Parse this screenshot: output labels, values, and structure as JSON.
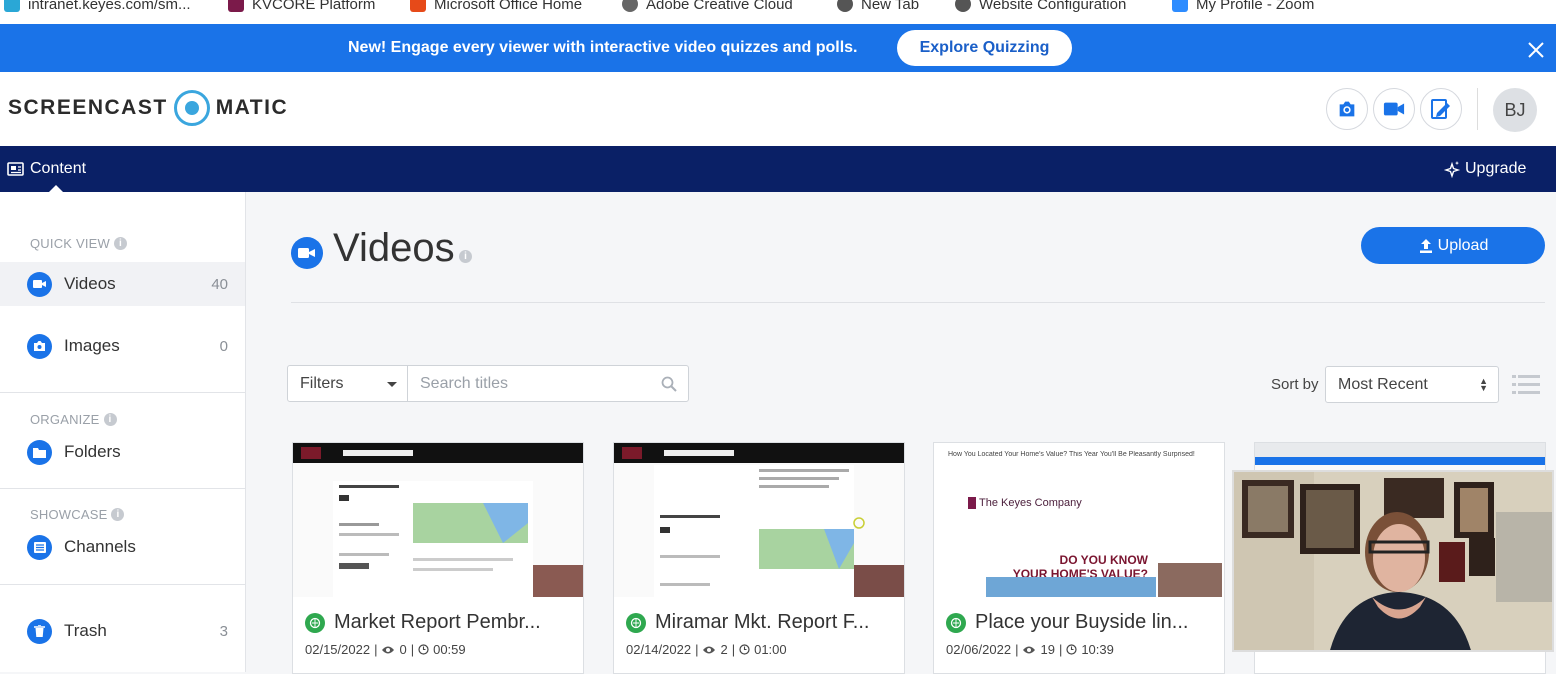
{
  "bookmarks": [
    {
      "label": "intranet.keyes.com/sm..."
    },
    {
      "label": "KVCORE Platform"
    },
    {
      "label": "Microsoft Office Home"
    },
    {
      "label": "Adobe Creative Cloud"
    },
    {
      "label": "New Tab"
    },
    {
      "label": "Website Configuration"
    },
    {
      "label": "My Profile - Zoom"
    }
  ],
  "promo": {
    "text": "New! Engage every viewer with interactive video quizzes and polls.",
    "button": "Explore Quizzing"
  },
  "header": {
    "logo_left": "SCREENCAST",
    "logo_right": "MATIC",
    "avatar_initials": "BJ"
  },
  "navbar": {
    "content_label": "Content",
    "upgrade_label": "Upgrade"
  },
  "sidebar": {
    "quick_view_title": "QUICK VIEW",
    "organize_title": "ORGANIZE",
    "showcase_title": "SHOWCASE",
    "items": [
      {
        "label": "Videos",
        "count": "40",
        "icon": "video-camera-icon"
      },
      {
        "label": "Images",
        "count": "0",
        "icon": "camera-icon"
      },
      {
        "label": "Folders",
        "count": "",
        "icon": "folder-icon"
      },
      {
        "label": "Channels",
        "count": "",
        "icon": "list-icon"
      },
      {
        "label": "Trash",
        "count": "3",
        "icon": "trash-icon"
      }
    ]
  },
  "main": {
    "title": "Videos",
    "upload_label": "Upload",
    "filters_label": "Filters",
    "search_placeholder": "Search titles",
    "sort_label": "Sort by",
    "sort_value": "Most Recent"
  },
  "cards": [
    {
      "title": "Market Report Pembr...",
      "date": "02/15/2022",
      "views": "0",
      "duration": "00:59"
    },
    {
      "title": "Miramar Mkt. Report F...",
      "date": "02/14/2022",
      "views": "2",
      "duration": "01:00"
    },
    {
      "title": "Place your Buyside lin...",
      "date": "02/06/2022",
      "views": "19",
      "duration": "10:39"
    },
    {
      "title": "",
      "date": "",
      "views": "",
      "duration": ""
    }
  ],
  "thumb3": {
    "headline": "How You Located Your Home's Value? This Year You'll Be Pleasantly Surprised!",
    "brand": "The Keyes Company",
    "question_line1": "DO YOU KNOW",
    "question_line2": "YOUR HOME'S VALUE?"
  },
  "colors": {
    "brand_blue": "#1a73e8",
    "navbar": "#0a2066",
    "status_green": "#2fa84f"
  }
}
